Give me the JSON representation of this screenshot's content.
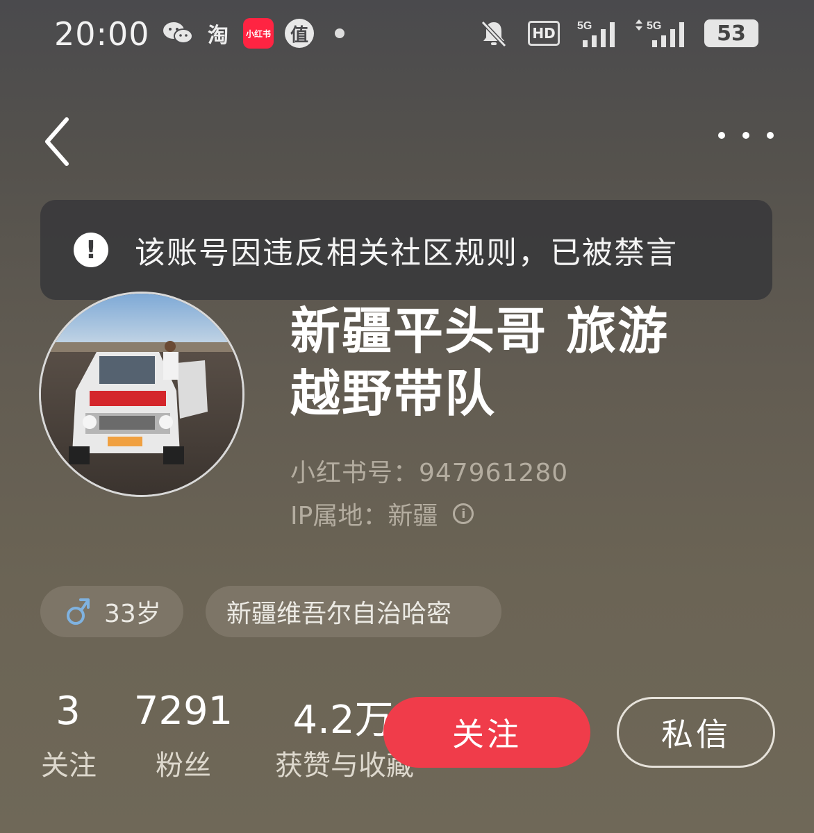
{
  "status_bar": {
    "time": "20:00",
    "taobao_glyph": "淘",
    "xhs_logo": "小红书",
    "zhi_glyph": "值",
    "hd_label": "HD",
    "net1": "5G",
    "net2": "5G",
    "battery": "53",
    "icons": [
      "wechat-icon",
      "taobao-icon",
      "xiaohongshu-icon",
      "zhi-icon",
      "notification-dot",
      "mute-bell-icon",
      "hd-icon",
      "signal-5g-icon",
      "signal-5g-icon",
      "battery-icon"
    ]
  },
  "nav": {
    "back_icon": "chevron-left-icon",
    "more_icon": "more-dots-icon"
  },
  "banner": {
    "icon": "alert-icon",
    "alert_glyph": "!",
    "text": "该账号因违反相关社区规则，已被禁言"
  },
  "profile": {
    "nickname": "新疆平头哥 旅游越野带队",
    "xhs_id": "小红书号：947961280",
    "ip_location": "IP属地：新疆",
    "info_glyph": "i"
  },
  "tags": {
    "age": "33岁",
    "location": "新疆维吾尔自治哈密"
  },
  "stats": {
    "following_count": "3",
    "following_label": "关注",
    "followers_count": "7291",
    "followers_label": "粉丝",
    "likes_count": "4.2万",
    "likes_label": "获赞与收藏"
  },
  "actions": {
    "follow": "关注",
    "message": "私信"
  },
  "colors": {
    "follow_button": "#f03c4a",
    "xhs_brand": "#ff2442"
  }
}
